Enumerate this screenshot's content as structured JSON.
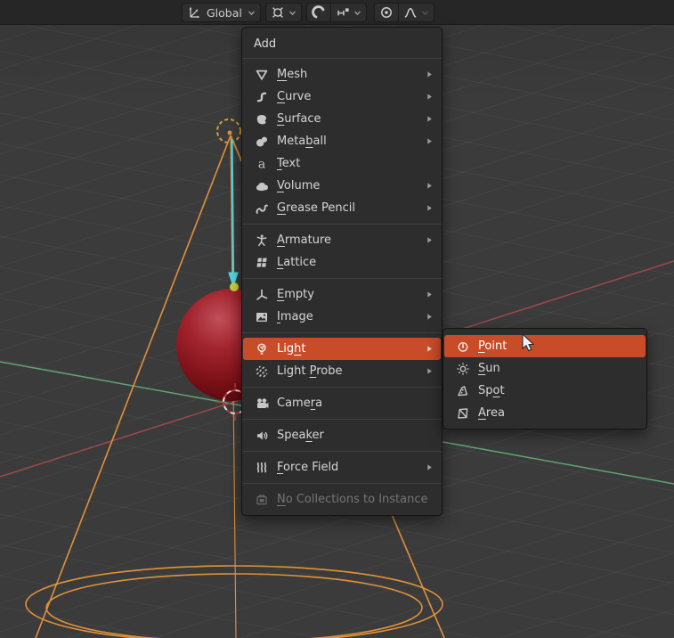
{
  "colors": {
    "viewport_bg": "#3b3b3b",
    "header_bg": "#262626",
    "menu_bg": "#2d2d2d",
    "menu_text": "#d6d6d6",
    "highlight": "#c84c28",
    "cone_orange": "#e0923a",
    "gizmo_dash_orange": "#d99c3c",
    "gizmo_cyan": "#55d8e2",
    "origin_yellow": "#ccd13d",
    "axis_x_red": "#9d4a4a",
    "axis_y_green": "#5fa571",
    "cursor_red": "#c23b3b",
    "cursor_white": "#e6e6e6",
    "sphere_red": "#a3242e"
  },
  "toolbar": {
    "groups": [
      {
        "name": "transform-orientation",
        "buttons": [
          {
            "icon": "orientation-axes",
            "label": "Global",
            "chevron": true
          }
        ]
      },
      {
        "name": "snap-target",
        "buttons": [
          {
            "icon": "snap-circle-x",
            "chevron": true
          }
        ]
      },
      {
        "name": "snapping",
        "buttons": [
          {
            "icon": "magnet"
          },
          {
            "icon": "increment-snap",
            "chevron": true
          }
        ]
      },
      {
        "name": "proportional-editing",
        "buttons": [
          {
            "icon": "proportional-circle"
          },
          {
            "icon": "falloff-curve",
            "chevron": true,
            "chevron_disabled": true
          }
        ]
      }
    ]
  },
  "add_menu": {
    "title": "Add",
    "items": [
      {
        "label": "Mesh",
        "icon": "mesh",
        "underline": 0,
        "submenu": true
      },
      {
        "label": "Curve",
        "icon": "curve",
        "underline": 0,
        "submenu": true
      },
      {
        "label": "Surface",
        "icon": "surface",
        "underline": 0,
        "submenu": true
      },
      {
        "label": "Metaball",
        "icon": "metaball",
        "underline": 4,
        "submenu": true
      },
      {
        "label": "Text",
        "icon": "text",
        "underline": 0
      },
      {
        "label": "Volume",
        "icon": "volume",
        "underline": 0,
        "submenu": true
      },
      {
        "label": "Grease Pencil",
        "icon": "grease-pencil",
        "underline": 0,
        "submenu": true,
        "sep_after": true
      },
      {
        "label": "Armature",
        "icon": "armature",
        "underline": 0,
        "submenu": true
      },
      {
        "label": "Lattice",
        "icon": "lattice",
        "underline": 0,
        "sep_after": true
      },
      {
        "label": "Empty",
        "icon": "empty-axes",
        "underline": 0,
        "submenu": true
      },
      {
        "label": "Image",
        "icon": "image",
        "underline": 0,
        "submenu": true,
        "sep_after": true
      },
      {
        "label": "Light",
        "icon": "light-bulb",
        "underline": 3,
        "submenu": true,
        "highlighted": true
      },
      {
        "label": "Light Probe",
        "icon": "light-probe",
        "underline": 6,
        "submenu": true,
        "sep_after": true
      },
      {
        "label": "Camera",
        "icon": "camera",
        "underline": 4,
        "sep_after": true
      },
      {
        "label": "Speaker",
        "icon": "speaker",
        "underline": 4,
        "sep_after": true
      },
      {
        "label": "Force Field",
        "icon": "force-field",
        "underline": 0,
        "submenu": true,
        "sep_after": true
      },
      {
        "label": "No Collections to Instance",
        "icon": "collection-instance",
        "underline": 0,
        "disabled": true
      }
    ]
  },
  "light_submenu": {
    "items": [
      {
        "label": "Point",
        "icon": "light-point",
        "underline": 0,
        "highlighted": true
      },
      {
        "label": "Sun",
        "icon": "light-sun",
        "underline": 0
      },
      {
        "label": "Spot",
        "icon": "light-spot",
        "underline": 2
      },
      {
        "label": "Area",
        "icon": "light-area",
        "underline": 0
      }
    ]
  }
}
